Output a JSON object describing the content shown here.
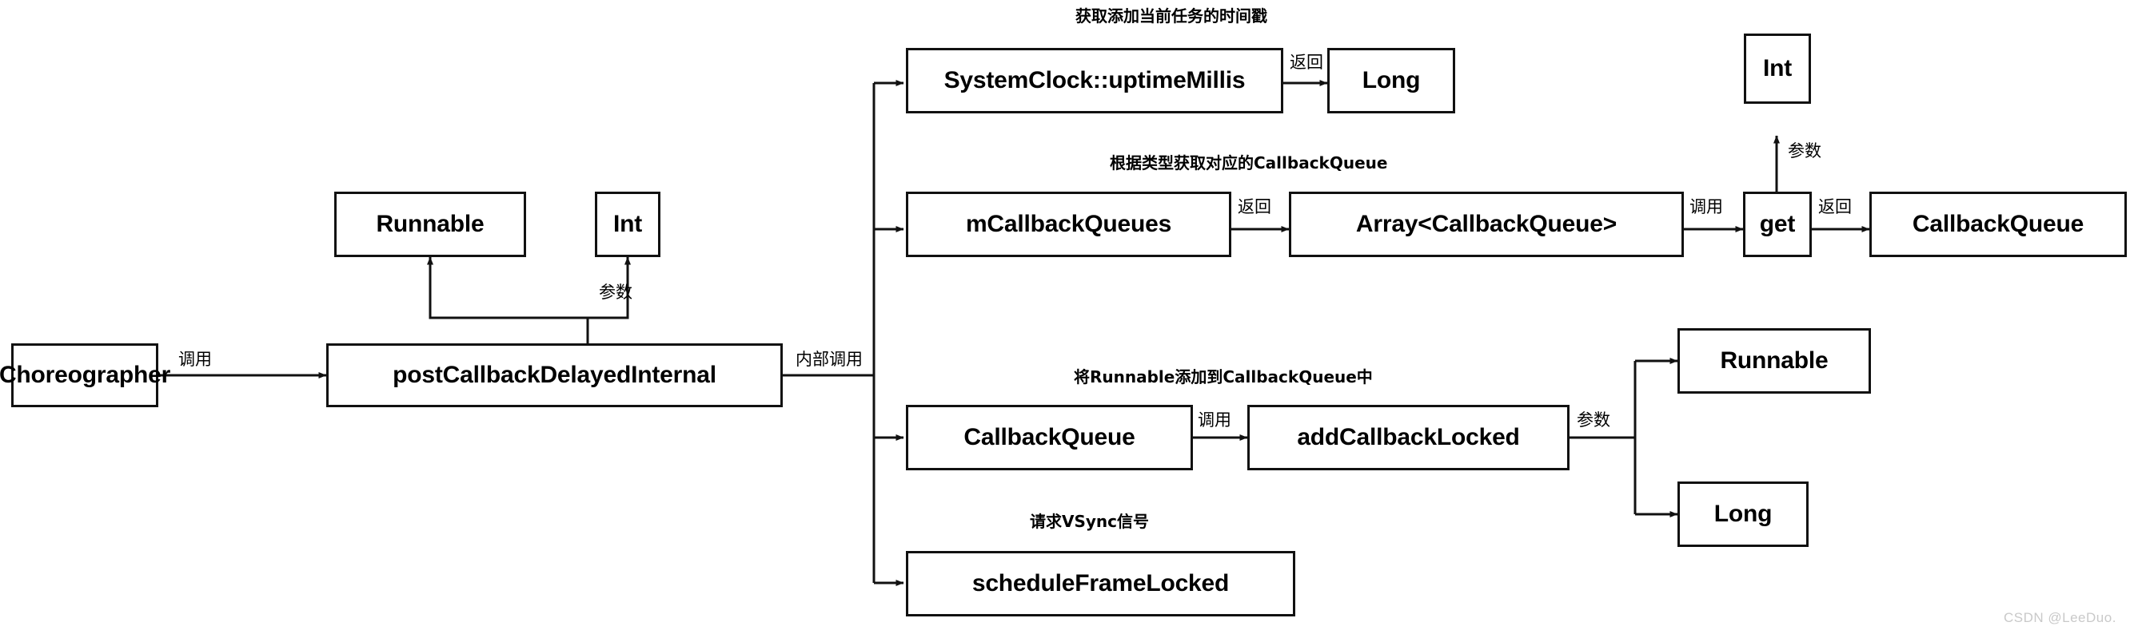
{
  "diagram": {
    "title": "Choreographer postCallbackDelayedInternal flow",
    "watermark": "CSDN @LeeDuo.",
    "colors": {
      "stroke": "#111111",
      "background": "#ffffff",
      "text": "#000000",
      "watermark": "#c9c9c9"
    },
    "nodes": {
      "choreographer": "Choreographer",
      "post_callback_delayed_internal": "postCallbackDelayedInternal",
      "runnable_param": "Runnable",
      "int_param": "Int",
      "system_clock_uptime_millis": "SystemClock::uptimeMillis",
      "long_return_top": "Long",
      "m_callback_queues": "mCallbackQueues",
      "array_callback_queue": "Array<CallbackQueue>",
      "get": "get",
      "int_get_param": "Int",
      "callback_queue_return": "CallbackQueue",
      "callback_queue": "CallbackQueue",
      "add_callback_locked": "addCallbackLocked",
      "runnable_arg": "Runnable",
      "long_arg": "Long",
      "schedule_frame_locked": "scheduleFrameLocked"
    },
    "edge_labels": {
      "choreographer_to_post": "调用",
      "post_params": "参数",
      "post_internal_call": "内部调用",
      "uptime_to_long": "返回",
      "queues_to_array": "返回",
      "array_to_get": "调用",
      "get_param": "参数",
      "get_to_callbackqueue": "返回",
      "queue_to_add": "调用",
      "add_params": "参数"
    },
    "annotations": {
      "row1": "获取添加当前任务的时间戳",
      "row2": "根据类型获取对应的CallbackQueue",
      "row3": "将Runnable添加到CallbackQueue中",
      "row4": "请求VSync信号"
    }
  }
}
